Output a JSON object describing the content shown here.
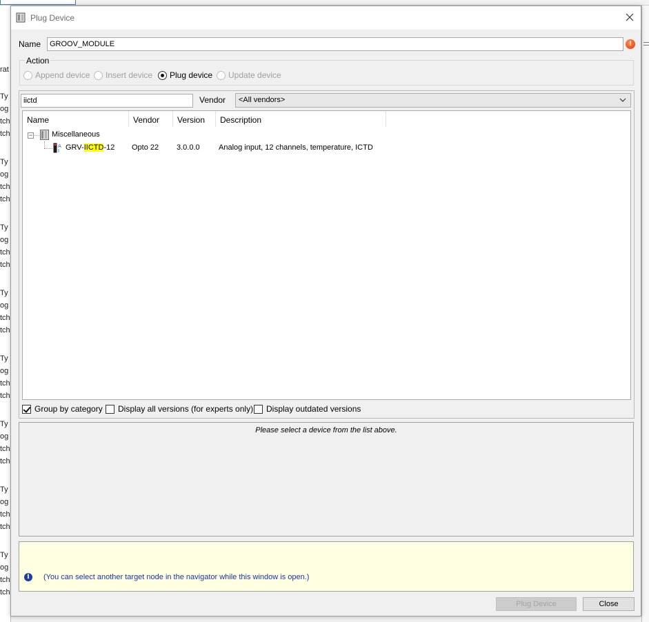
{
  "background": {
    "left_fragments": [
      "Ty",
      "og",
      "tcho",
      "tcho",
      "rat",
      "Ty",
      "og",
      "tcho",
      "tcho",
      "Ty",
      "og",
      "tcho",
      "tcho",
      "Ty",
      "og",
      "tcho",
      "tcho",
      "Ty",
      "og",
      "tcho",
      "tcho",
      "Ty",
      "og",
      "tcho",
      "tcho",
      "Ty",
      "og",
      "tcho",
      "tcho",
      "Ty",
      "og",
      "tcho",
      "tcho"
    ]
  },
  "dialog": {
    "title": "Plug Device",
    "name_label": "Name",
    "name_value": "GROOV_MODULE",
    "action_label": "Action",
    "actions": [
      {
        "label": "Append device",
        "checked": false,
        "enabled": false
      },
      {
        "label": "Insert device",
        "checked": false,
        "enabled": false
      },
      {
        "label": "Plug device",
        "checked": true,
        "enabled": true
      },
      {
        "label": "Update device",
        "checked": false,
        "enabled": false
      }
    ],
    "search_value": "iictd",
    "vendor_label": "Vendor",
    "vendor_selected": "<All vendors>",
    "columns": [
      "Name",
      "Vendor",
      "Version",
      "Description"
    ],
    "tree": {
      "category": "Miscellaneous",
      "device": {
        "name_prefix": "GRV-",
        "name_match": "IICTD",
        "name_suffix": "-12",
        "vendor": "Opto 22",
        "version": "3.0.0.0",
        "description": "Analog input, 12 channels, temperature, ICTD"
      }
    },
    "options": [
      {
        "label": "Group by category",
        "checked": true
      },
      {
        "label": "Display all versions (for experts only)",
        "checked": false
      },
      {
        "label": "Display outdated versions",
        "checked": false
      }
    ],
    "info_message": "Please select a device from the list above.",
    "note": "(You can select another target node in the navigator while this window is open.)",
    "buttons": {
      "plug": "Plug Device",
      "close": "Close"
    },
    "colors": {
      "highlight": "#ffff00",
      "note_bg": "#ffffe1",
      "note_text": "#1a33a8",
      "warning": "#e03b00"
    }
  }
}
